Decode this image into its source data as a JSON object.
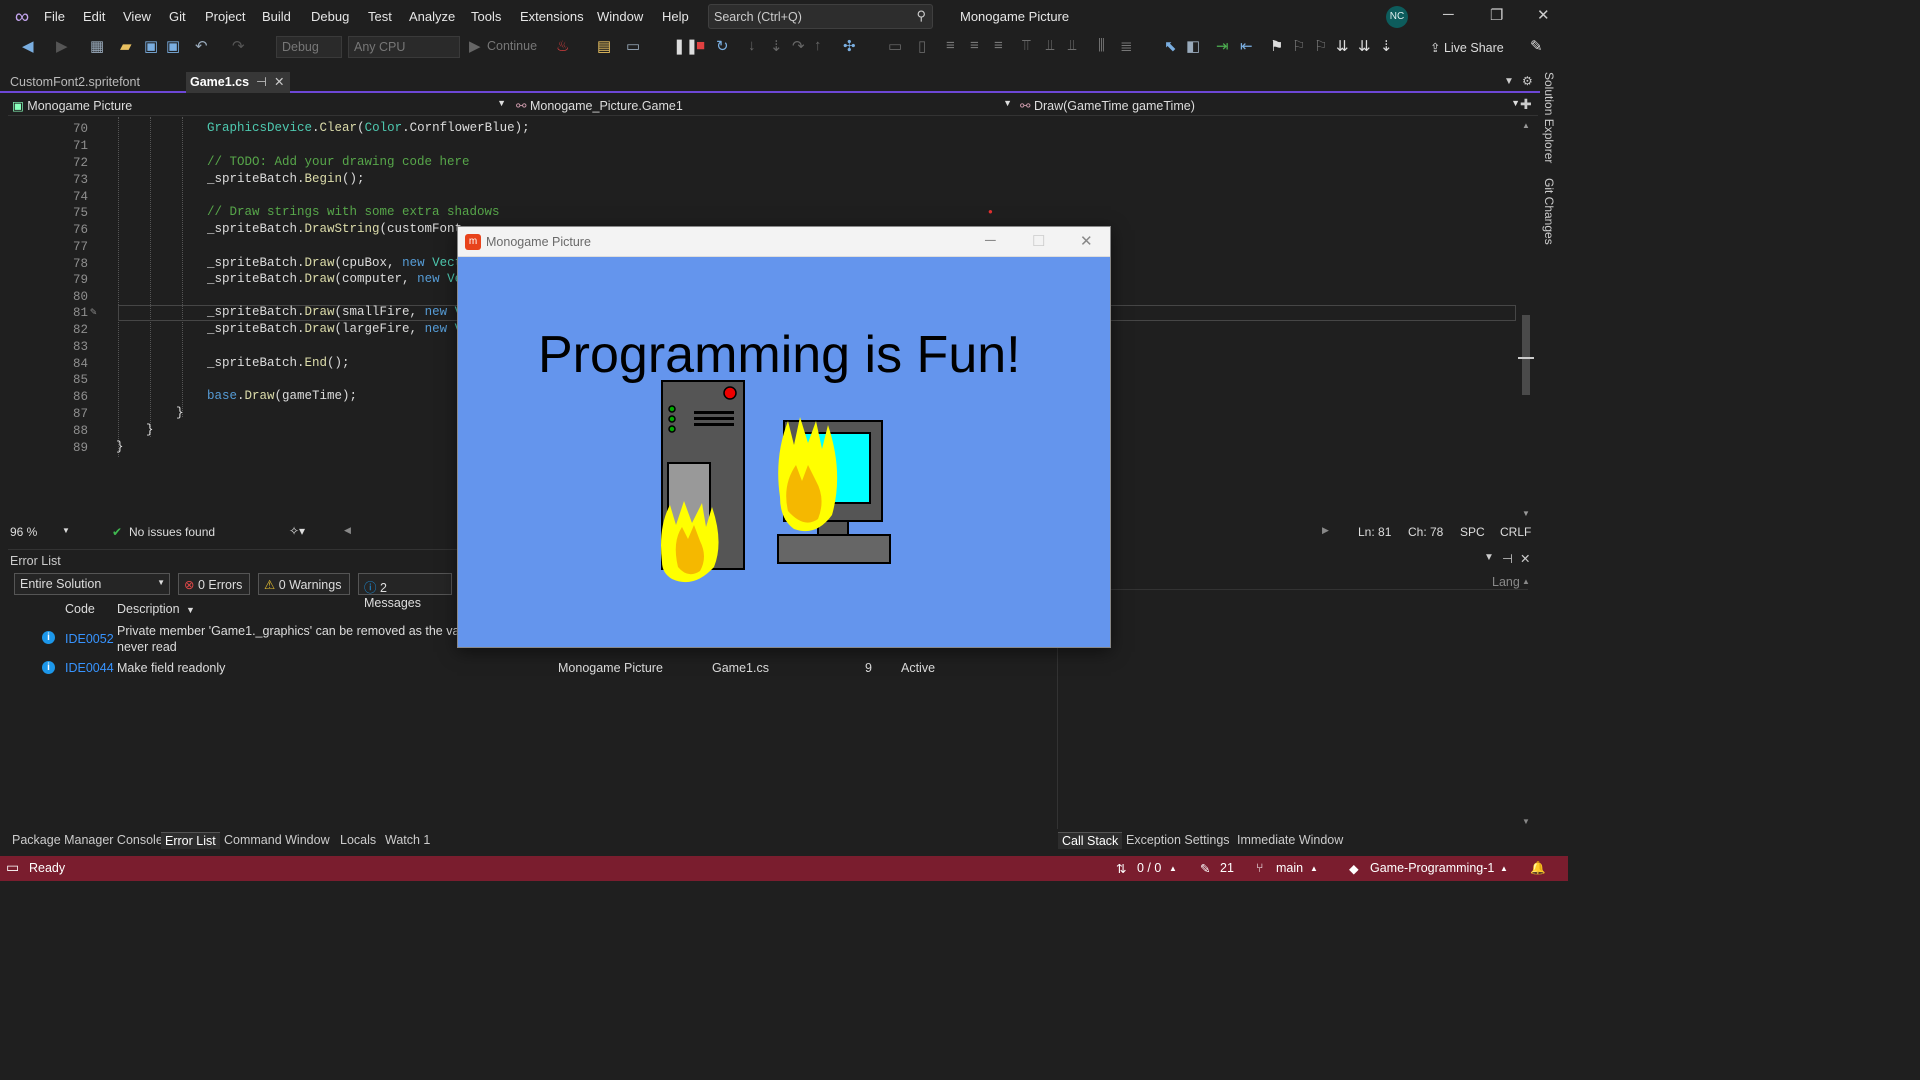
{
  "menu": [
    "File",
    "Edit",
    "View",
    "Git",
    "Project",
    "Build",
    "Debug",
    "Test",
    "Analyze",
    "Tools",
    "Extensions",
    "Window",
    "Help"
  ],
  "search": {
    "placeholder": "Search (Ctrl+Q)"
  },
  "app_title": "Monogame Picture",
  "avatar": "NC",
  "toolbar": {
    "config": "Debug",
    "platform": "Any CPU",
    "continue": "Continue",
    "live_share": "Live Share"
  },
  "tabs": [
    {
      "label": "CustomFont2.spritefont"
    },
    {
      "label": "Game1.cs"
    }
  ],
  "nav": {
    "project": "Monogame Picture",
    "class": "Monogame_Picture.Game1",
    "member": "Draw(GameTime gameTime)"
  },
  "editor": {
    "lines": [
      {
        "n": "70",
        "t": "GraphicsDevice.Clear(Color.CornflowerBlue);"
      },
      {
        "n": "71",
        "t": ""
      },
      {
        "n": "72",
        "t": "// TODO: Add your drawing code here"
      },
      {
        "n": "73",
        "t": "_spriteBatch.Begin();"
      },
      {
        "n": "74",
        "t": ""
      },
      {
        "n": "75",
        "t": "// Draw strings with some extra shadows"
      },
      {
        "n": "76",
        "t": "_spriteBatch.DrawString(customFont"
      },
      {
        "n": "77",
        "t": ""
      },
      {
        "n": "78",
        "t": "_spriteBatch.Draw(cpuBox, new Vect"
      },
      {
        "n": "79",
        "t": "_spriteBatch.Draw(computer, new Ve"
      },
      {
        "n": "80",
        "t": ""
      },
      {
        "n": "81",
        "t": "_spriteBatch.Draw(smallFire, new V"
      },
      {
        "n": "82",
        "t": "_spriteBatch.Draw(largeFire, new V"
      },
      {
        "n": "83",
        "t": ""
      },
      {
        "n": "84",
        "t": "_spriteBatch.End();"
      },
      {
        "n": "85",
        "t": ""
      },
      {
        "n": "86",
        "t": "base.Draw(gameTime);"
      },
      {
        "n": "87",
        "t": "}"
      },
      {
        "n": "88",
        "t": "}"
      },
      {
        "n": "89",
        "t": "}"
      }
    ]
  },
  "editor_status": {
    "zoom": "96 %",
    "issues": "No issues found",
    "ln": "Ln: 81",
    "ch": "Ch: 78",
    "spc": "SPC",
    "crlf": "CRLF"
  },
  "error_list": {
    "title": "Error List",
    "scope": "Entire Solution",
    "errors": "0 Errors",
    "warnings": "0 Warnings",
    "messages": "2 Messages",
    "col_code": "Code",
    "col_desc": "Description",
    "rows": [
      {
        "code": "IDE0052",
        "desc": "Private member 'Game1._graphics' can be removed as the value",
        "desc2": "never read"
      },
      {
        "code": "IDE0044",
        "desc": "Make field readonly",
        "project": "Monogame Picture",
        "file": "Game1.cs",
        "line": "9",
        "state": "Active"
      }
    ]
  },
  "right_panel": {
    "lang": "Lang"
  },
  "bottom_tabs": [
    "Package Manager Console",
    "Error List",
    "Command Window",
    "Locals",
    "Watch 1"
  ],
  "right_tabs": [
    "Call Stack",
    "Exception Settings",
    "Immediate Window"
  ],
  "side": [
    "Solution Explorer",
    "Git Changes"
  ],
  "status": {
    "ready": "Ready",
    "updown": "0 / 0",
    "pencil": "21",
    "branch": "main",
    "repo": "Game-Programming-1"
  },
  "monogame": {
    "title": "Monogame Picture",
    "text": "Programming is Fun!"
  },
  "colors": {
    "accent": "#6d47d6",
    "statusbar": "#7a1d2e",
    "cornflower": "#6495ed"
  }
}
